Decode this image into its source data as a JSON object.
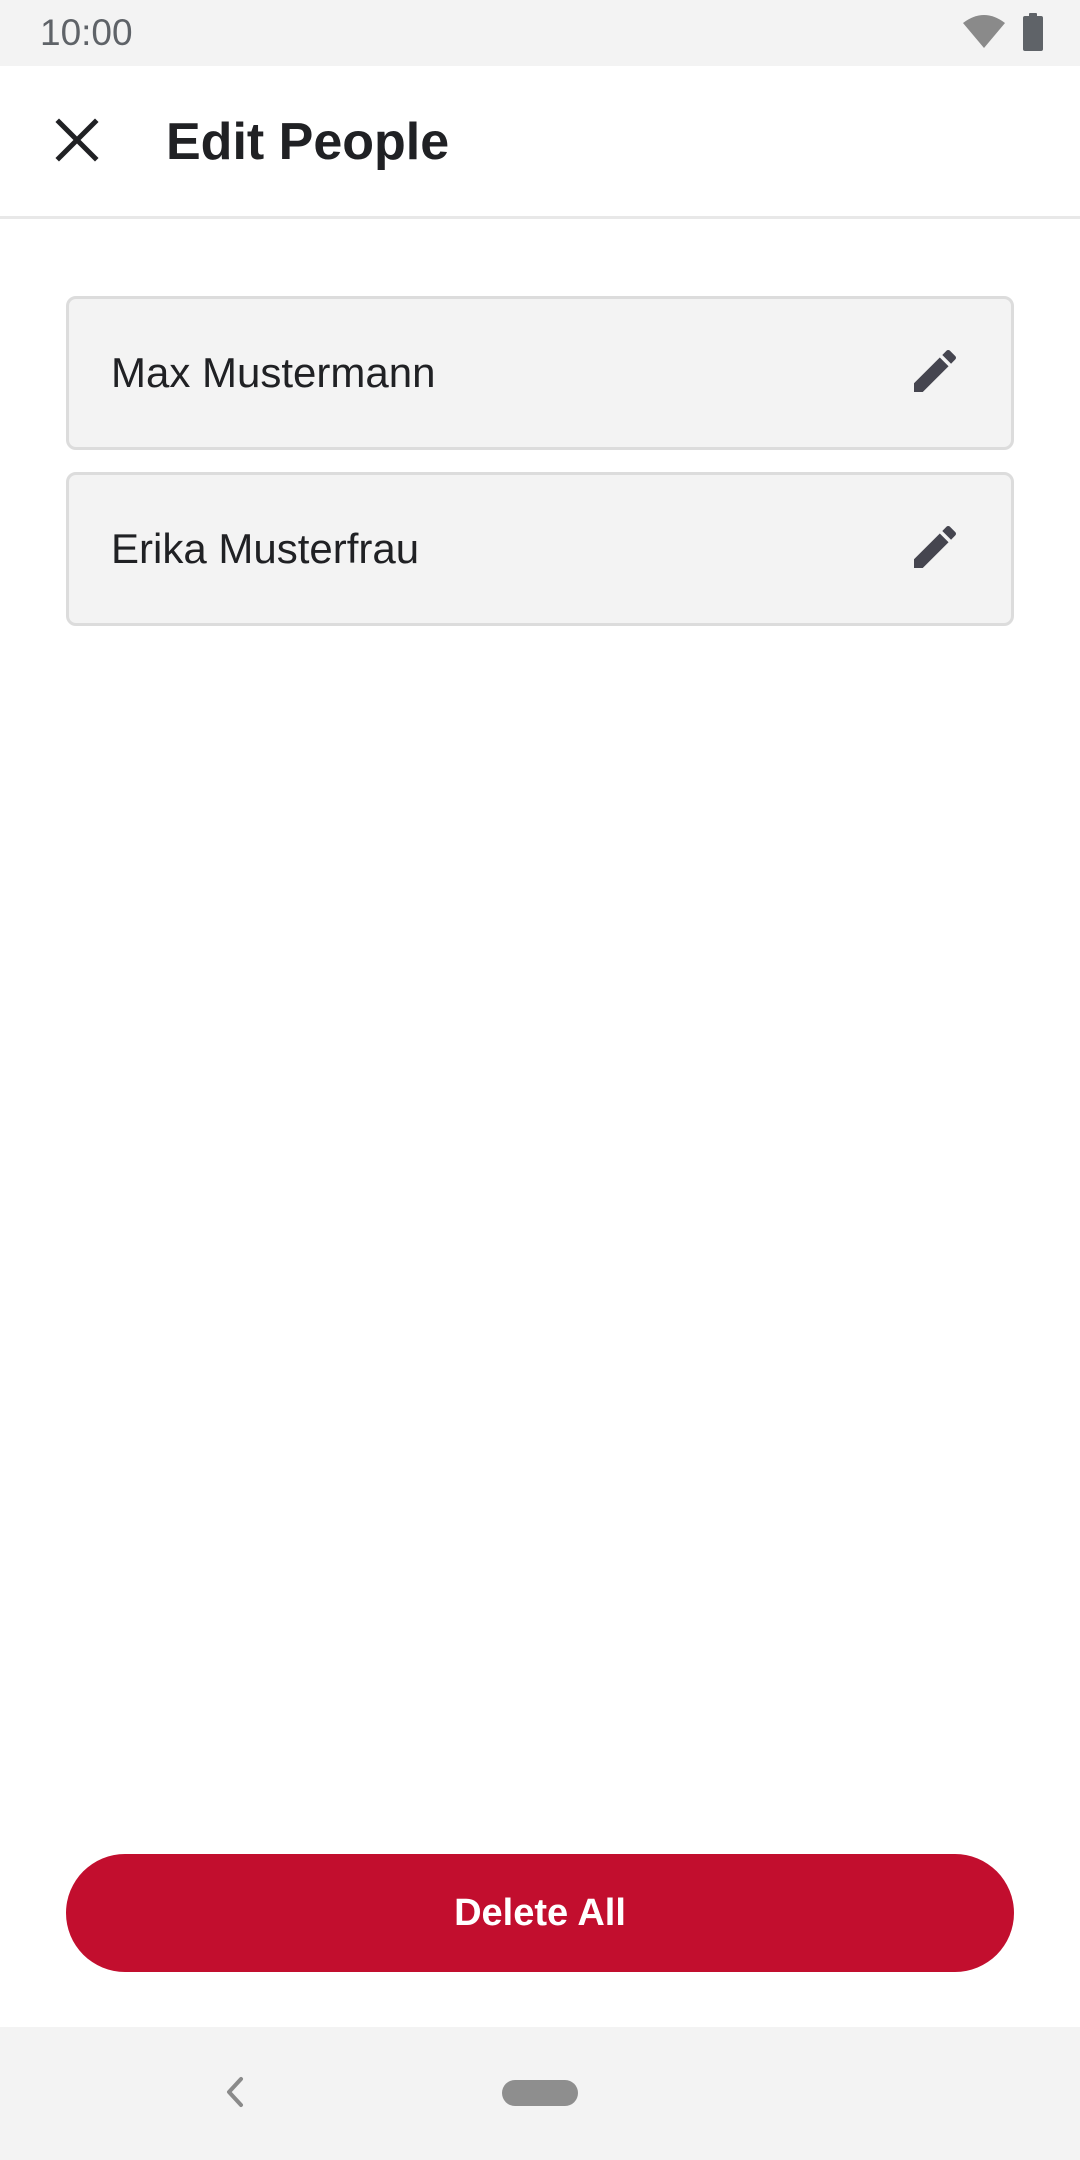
{
  "status_bar": {
    "time": "10:00",
    "icons": [
      "wifi-icon",
      "battery-icon"
    ]
  },
  "app_bar": {
    "close_icon": "close-icon",
    "title": "Edit People"
  },
  "people": [
    {
      "name": "Max Mustermann",
      "action_icon": "pencil-icon"
    },
    {
      "name": "Erika Musterfrau",
      "action_icon": "pencil-icon"
    }
  ],
  "footer": {
    "delete_all_label": "Delete All"
  },
  "nav_bar": {
    "back_icon": "back-chevron-icon",
    "home_icon": "home-pill-icon"
  },
  "colors": {
    "accent": "#c20e2e",
    "card_background": "#f3f3f3",
    "card_border": "#dcdcdc",
    "icon_dark": "#45454f"
  }
}
